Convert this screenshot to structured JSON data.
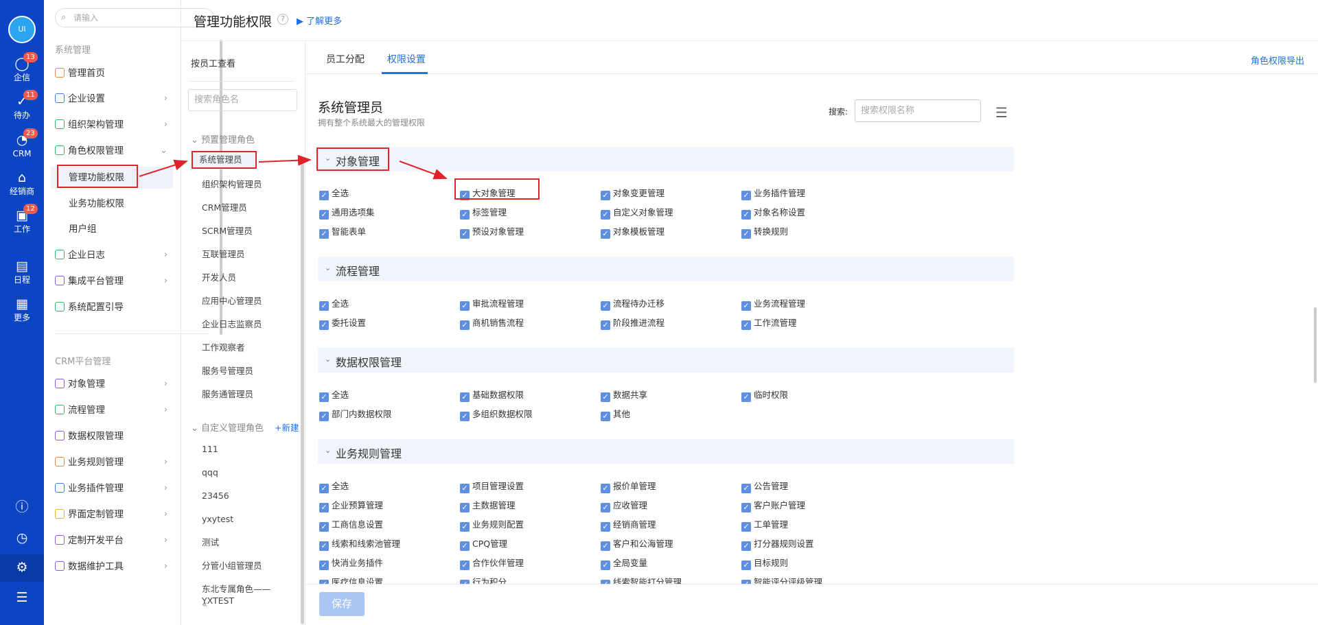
{
  "rail": {
    "avatar": "UI",
    "items": [
      {
        "label": "企信",
        "badge": "13",
        "icon": "chat-icon"
      },
      {
        "label": "待办",
        "badge": "11",
        "icon": "todo-icon"
      },
      {
        "label": "CRM",
        "badge": "23",
        "icon": "crm-icon"
      },
      {
        "label": "经销商",
        "badge": "",
        "icon": "dealer-icon"
      },
      {
        "label": "工作",
        "badge": "12",
        "icon": "work-icon"
      },
      {
        "label": "日程",
        "badge": "",
        "icon": "calendar-icon"
      },
      {
        "label": "更多",
        "badge": "",
        "icon": "more-icon"
      }
    ]
  },
  "menu": {
    "search_placeholder": "请输入",
    "group1": "系统管理",
    "items1": [
      "管理首页",
      "企业设置",
      "组织架构管理",
      "角色权限管理",
      "管理功能权限",
      "业务功能权限",
      "用户组",
      "企业日志",
      "集成平台管理",
      "系统配置引导"
    ],
    "group2": "CRM平台管理",
    "items2": [
      "对象管理",
      "流程管理",
      "数据权限管理",
      "业务规则管理",
      "业务插件管理",
      "界面定制管理",
      "定制开发平台",
      "数据维护工具"
    ],
    "collapse": "«"
  },
  "header": {
    "title": "管理功能权限",
    "help": "?",
    "learn_more": "了解更多"
  },
  "roles": {
    "view_by": "按员工查看",
    "search_placeholder": "搜索角色名",
    "preset_group": "预置管理角色",
    "preset": [
      "系统管理员",
      "组织架构管理员",
      "CRM管理员",
      "SCRM管理员",
      "互联管理员",
      "开发人员",
      "应用中心管理员",
      "企业日志监察员",
      "工作观察者",
      "服务号管理员",
      "服务通管理员"
    ],
    "custom_group": "自定义管理角色",
    "new_label": "+新建",
    "custom": [
      "111",
      "qqq",
      "23456",
      "yxytest",
      "测试",
      "分管小组管理员",
      "东北专属角色——YXTEST"
    ]
  },
  "tabs": {
    "items": [
      "员工分配",
      "权限设置"
    ],
    "export": "角色权限导出"
  },
  "content": {
    "title": "系统管理员",
    "desc": "拥有整个系统最大的管理权限",
    "search_label": "搜索:",
    "search_placeholder": "搜索权限名称",
    "sections": [
      {
        "label": "对象管理",
        "items": [
          "全选",
          "大对象管理",
          "对象变更管理",
          "业务插件管理",
          "通用选项集",
          "标签管理",
          "自定义对象管理",
          "对象名称设置",
          "智能表单",
          "预设对象管理",
          "对象模板管理",
          "转换规则"
        ]
      },
      {
        "label": "流程管理",
        "items": [
          "全选",
          "审批流程管理",
          "流程待办迁移",
          "业务流程管理",
          "委托设置",
          "商机销售流程",
          "阶段推进流程",
          "工作流管理"
        ]
      },
      {
        "label": "数据权限管理",
        "items": [
          "全选",
          "基础数据权限",
          "数据共享",
          "临时权限",
          "部门内数据权限",
          "多组织数据权限",
          "其他"
        ]
      },
      {
        "label": "业务规则管理",
        "items": [
          "全选",
          "项目管理设置",
          "报价单管理",
          "公告管理",
          "企业预算管理",
          "主数据管理",
          "应收管理",
          "客户账户管理",
          "工商信息设置",
          "业务规则配置",
          "经销商管理",
          "工单管理",
          "线索和线索池管理",
          "CPQ管理",
          "客户和公海管理",
          "打分器规则设置",
          "快消业务插件",
          "合作伙伴管理",
          "全局变量",
          "目标规则",
          "医疗信息设置",
          "行为积分",
          "线索智能打分管理",
          "智能评分评级管理"
        ]
      }
    ]
  },
  "footer": {
    "save": "保存"
  },
  "colors": {
    "rail": "#0c45c4",
    "accent": "#1f6fe5",
    "highlight": "#e0232b"
  }
}
